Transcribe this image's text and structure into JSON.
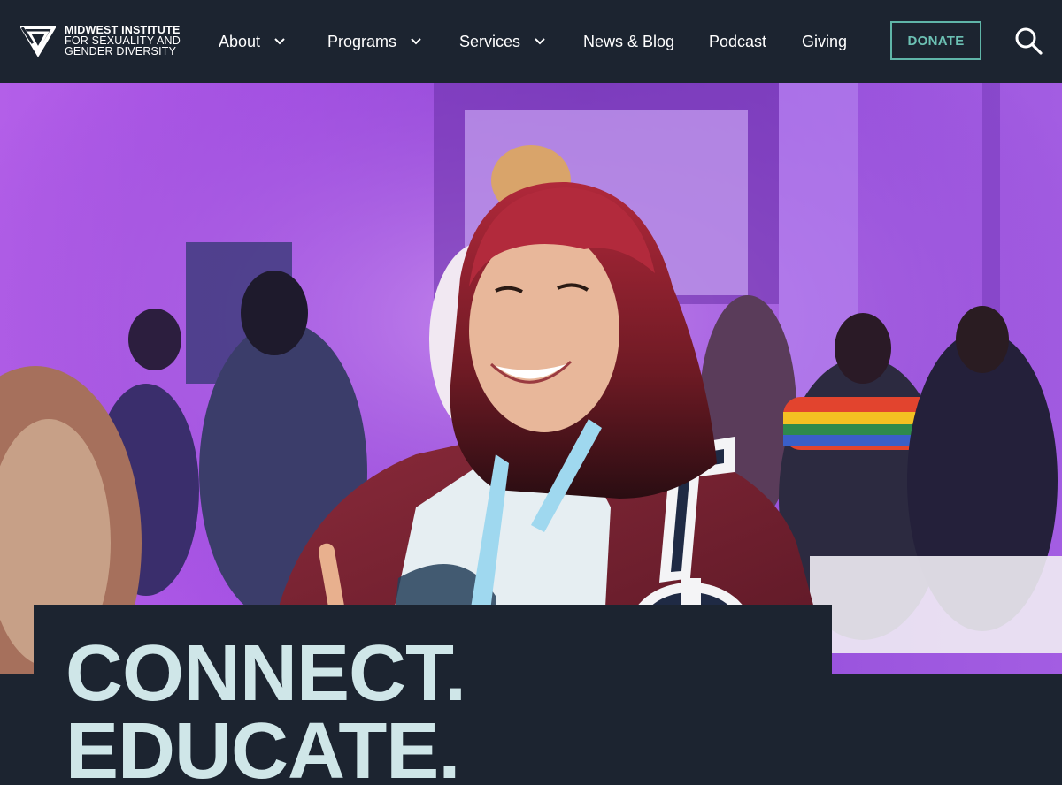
{
  "logo": {
    "line1": "MIDWEST INSTITUTE",
    "line2": "FOR SEXUALITY AND",
    "line3": "GENDER DIVERSITY",
    "icon": "triangle-logo-icon"
  },
  "nav": {
    "items": [
      {
        "label": "About",
        "has_dropdown": true
      },
      {
        "label": "Programs",
        "has_dropdown": true
      },
      {
        "label": "Services",
        "has_dropdown": true
      },
      {
        "label": "News & Blog",
        "has_dropdown": false
      },
      {
        "label": "Podcast",
        "has_dropdown": false
      },
      {
        "label": "Giving",
        "has_dropdown": false
      }
    ],
    "donate_label": "DONATE",
    "search_icon": "search-icon"
  },
  "hero": {
    "image": "Smiling person with red hair wearing a maroon jacket and lanyard at a purple-lit event",
    "headline_line1": "CONNECT.",
    "headline_line2": "EDUCATE."
  },
  "colors": {
    "header_bg": "#1c2430",
    "accent": "#5fb5a8",
    "headline": "#cfe6e8",
    "hero_purple": "#a550e4"
  }
}
